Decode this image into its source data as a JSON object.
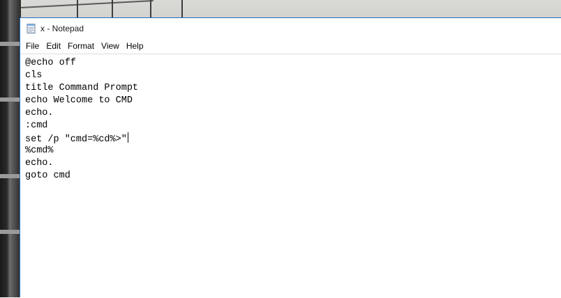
{
  "window": {
    "title": "x - Notepad",
    "app_icon": "notepad-icon",
    "accent_color": "#1f6fb8"
  },
  "menubar": {
    "items": [
      {
        "label": "File"
      },
      {
        "label": "Edit"
      },
      {
        "label": "Format"
      },
      {
        "label": "View"
      },
      {
        "label": "Help"
      }
    ]
  },
  "editor": {
    "lines": [
      "@echo off",
      "cls",
      "title Command Prompt",
      "echo Welcome to CMD",
      "echo.",
      ":cmd",
      "set /p \"cmd=%cd%>\"",
      "%cmd%",
      "echo.",
      "goto cmd"
    ],
    "caret_line_index": 6
  }
}
